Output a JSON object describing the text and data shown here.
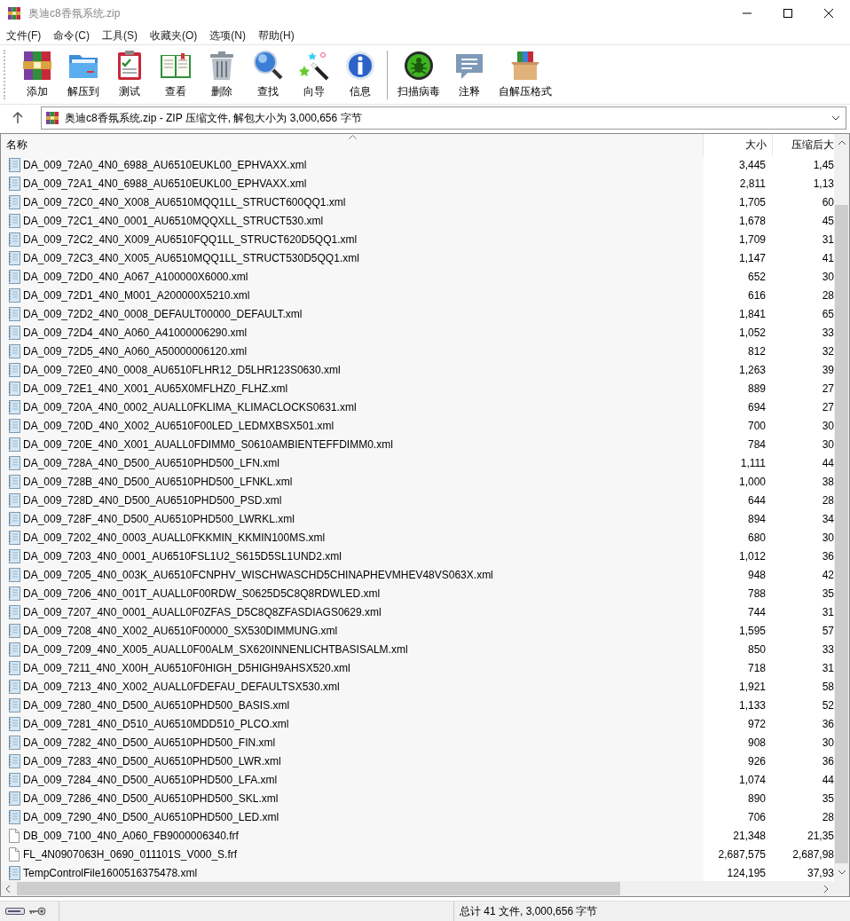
{
  "window": {
    "title": "奥迪c8香氛系统.zip"
  },
  "menu": [
    "文件(F)",
    "命令(C)",
    "工具(S)",
    "收藏夹(O)",
    "选项(N)",
    "帮助(H)"
  ],
  "toolbar": [
    {
      "kind": "add",
      "label": "添加"
    },
    {
      "kind": "extract",
      "label": "解压到"
    },
    {
      "kind": "test",
      "label": "测试"
    },
    {
      "kind": "view",
      "label": "查看"
    },
    {
      "kind": "delete",
      "label": "删除"
    },
    {
      "kind": "find",
      "label": "查找"
    },
    {
      "kind": "wizard",
      "label": "向导"
    },
    {
      "kind": "info",
      "label": "信息"
    },
    {
      "kind": "separator"
    },
    {
      "kind": "scan",
      "label": "扫描病毒"
    },
    {
      "kind": "comment",
      "label": "注释"
    },
    {
      "kind": "sfx",
      "label": "自解压格式"
    }
  ],
  "address": {
    "path": "奥迪c8香氛系统.zip - ZIP 压缩文件, 解包大小为 3,000,656 字节"
  },
  "table": {
    "columns": [
      "名称",
      "大小",
      "压缩后大"
    ],
    "rows": [
      {
        "kind": "xml",
        "name": "DA_009_72A0_4N0_6988_AU6510EUKL00_EPHVAXX.xml",
        "size": "3,445",
        "packed": "1,45"
      },
      {
        "kind": "xml",
        "name": "DA_009_72A1_4N0_6988_AU6510EUKL00_EPHVAXX.xml",
        "size": "2,811",
        "packed": "1,13"
      },
      {
        "kind": "xml",
        "name": "DA_009_72C0_4N0_X008_AU6510MQQ1LL_STRUCT600QQ1.xml",
        "size": "1,705",
        "packed": "60"
      },
      {
        "kind": "xml",
        "name": "DA_009_72C1_4N0_0001_AU6510MQQXLL_STRUCT530.xml",
        "size": "1,678",
        "packed": "45"
      },
      {
        "kind": "xml",
        "name": "DA_009_72C2_4N0_X009_AU6510FQQ1LL_STRUCT620D5QQ1.xml",
        "size": "1,709",
        "packed": "31"
      },
      {
        "kind": "xml",
        "name": "DA_009_72C3_4N0_X005_AU6510MQQ1LL_STRUCT530D5QQ1.xml",
        "size": "1,147",
        "packed": "41"
      },
      {
        "kind": "xml",
        "name": "DA_009_72D0_4N0_A067_A100000X6000.xml",
        "size": "652",
        "packed": "30"
      },
      {
        "kind": "xml",
        "name": "DA_009_72D1_4N0_M001_A200000X5210.xml",
        "size": "616",
        "packed": "28"
      },
      {
        "kind": "xml",
        "name": "DA_009_72D2_4N0_0008_DEFAULT00000_DEFAULT.xml",
        "size": "1,841",
        "packed": "65"
      },
      {
        "kind": "xml",
        "name": "DA_009_72D4_4N0_A060_A41000006290.xml",
        "size": "1,052",
        "packed": "33"
      },
      {
        "kind": "xml",
        "name": "DA_009_72D5_4N0_A060_A50000006120.xml",
        "size": "812",
        "packed": "32"
      },
      {
        "kind": "xml",
        "name": "DA_009_72E0_4N0_0008_AU6510FLHR12_D5LHR123S0630.xml",
        "size": "1,263",
        "packed": "39"
      },
      {
        "kind": "xml",
        "name": "DA_009_72E1_4N0_X001_AU65X0MFLHZ0_FLHZ.xml",
        "size": "889",
        "packed": "27"
      },
      {
        "kind": "xml",
        "name": "DA_009_720A_4N0_0002_AUALL0FKLIMA_KLIMACLOCKS0631.xml",
        "size": "694",
        "packed": "27"
      },
      {
        "kind": "xml",
        "name": "DA_009_720D_4N0_X002_AU6510F00LED_LEDMXBSX501.xml",
        "size": "700",
        "packed": "30"
      },
      {
        "kind": "xml",
        "name": "DA_009_720E_4N0_X001_AUALL0FDIMM0_S0610AMBIENTEFFDIMM0.xml",
        "size": "784",
        "packed": "30"
      },
      {
        "kind": "xml",
        "name": "DA_009_728A_4N0_D500_AU6510PHD500_LFN.xml",
        "size": "1,111",
        "packed": "44"
      },
      {
        "kind": "xml",
        "name": "DA_009_728B_4N0_D500_AU6510PHD500_LFNKL.xml",
        "size": "1,000",
        "packed": "38"
      },
      {
        "kind": "xml",
        "name": "DA_009_728D_4N0_D500_AU6510PHD500_PSD.xml",
        "size": "644",
        "packed": "28"
      },
      {
        "kind": "xml",
        "name": "DA_009_728F_4N0_D500_AU6510PHD500_LWRKL.xml",
        "size": "894",
        "packed": "34"
      },
      {
        "kind": "xml",
        "name": "DA_009_7202_4N0_0003_AUALL0FKKMIN_KKMIN100MS.xml",
        "size": "680",
        "packed": "30"
      },
      {
        "kind": "xml",
        "name": "DA_009_7203_4N0_0001_AU6510FSL1U2_S615D5SL1UND2.xml",
        "size": "1,012",
        "packed": "36"
      },
      {
        "kind": "xml",
        "name": "DA_009_7205_4N0_003K_AU6510FCNPHV_WISCHWASCHD5CHINAPHEVMHEV48VS063X.xml",
        "size": "948",
        "packed": "42"
      },
      {
        "kind": "xml",
        "name": "DA_009_7206_4N0_001T_AUALL0F00RDW_S0625D5C8Q8RDWLED.xml",
        "size": "788",
        "packed": "35"
      },
      {
        "kind": "xml",
        "name": "DA_009_7207_4N0_0001_AUALL0F0ZFAS_D5C8Q8ZFASDIAGS0629.xml",
        "size": "744",
        "packed": "31"
      },
      {
        "kind": "xml",
        "name": "DA_009_7208_4N0_X002_AU6510F00000_SX530DIMMUNG.xml",
        "size": "1,595",
        "packed": "57"
      },
      {
        "kind": "xml",
        "name": "DA_009_7209_4N0_X005_AUALL0F00ALM_SX620INNENLICHTBASISALM.xml",
        "size": "850",
        "packed": "33"
      },
      {
        "kind": "xml",
        "name": "DA_009_7211_4N0_X00H_AU6510F0HIGH_D5HIGH9AHSX520.xml",
        "size": "718",
        "packed": "31"
      },
      {
        "kind": "xml",
        "name": "DA_009_7213_4N0_X002_AUALL0FDEFAU_DEFAULTSX530.xml",
        "size": "1,921",
        "packed": "58"
      },
      {
        "kind": "xml",
        "name": "DA_009_7280_4N0_D500_AU6510PHD500_BASIS.xml",
        "size": "1,133",
        "packed": "52"
      },
      {
        "kind": "xml",
        "name": "DA_009_7281_4N0_D510_AU6510MDD510_PLCO.xml",
        "size": "972",
        "packed": "36"
      },
      {
        "kind": "xml",
        "name": "DA_009_7282_4N0_D500_AU6510PHD500_FIN.xml",
        "size": "908",
        "packed": "30"
      },
      {
        "kind": "xml",
        "name": "DA_009_7283_4N0_D500_AU6510PHD500_LWR.xml",
        "size": "926",
        "packed": "36"
      },
      {
        "kind": "xml",
        "name": "DA_009_7284_4N0_D500_AU6510PHD500_LFA.xml",
        "size": "1,074",
        "packed": "44"
      },
      {
        "kind": "xml",
        "name": "DA_009_7286_4N0_D500_AU6510PHD500_SKL.xml",
        "size": "890",
        "packed": "35"
      },
      {
        "kind": "xml",
        "name": "DA_009_7290_4N0_D500_AU6510PHD500_LED.xml",
        "size": "706",
        "packed": "28"
      },
      {
        "kind": "file",
        "name": "DB_009_7100_4N0_A060_FB9000006340.frf",
        "size": "21,348",
        "packed": "21,35"
      },
      {
        "kind": "file",
        "name": "FL_4N0907063H_0690_011101S_V000_S.frf",
        "size": "2,687,575",
        "packed": "2,687,98"
      },
      {
        "kind": "xml",
        "name": "TempControlFile1600516375478.xml",
        "size": "124,195",
        "packed": "37,93"
      }
    ]
  },
  "status_bar": {
    "text": "总计 41 文件, 3,000,656 字节"
  }
}
